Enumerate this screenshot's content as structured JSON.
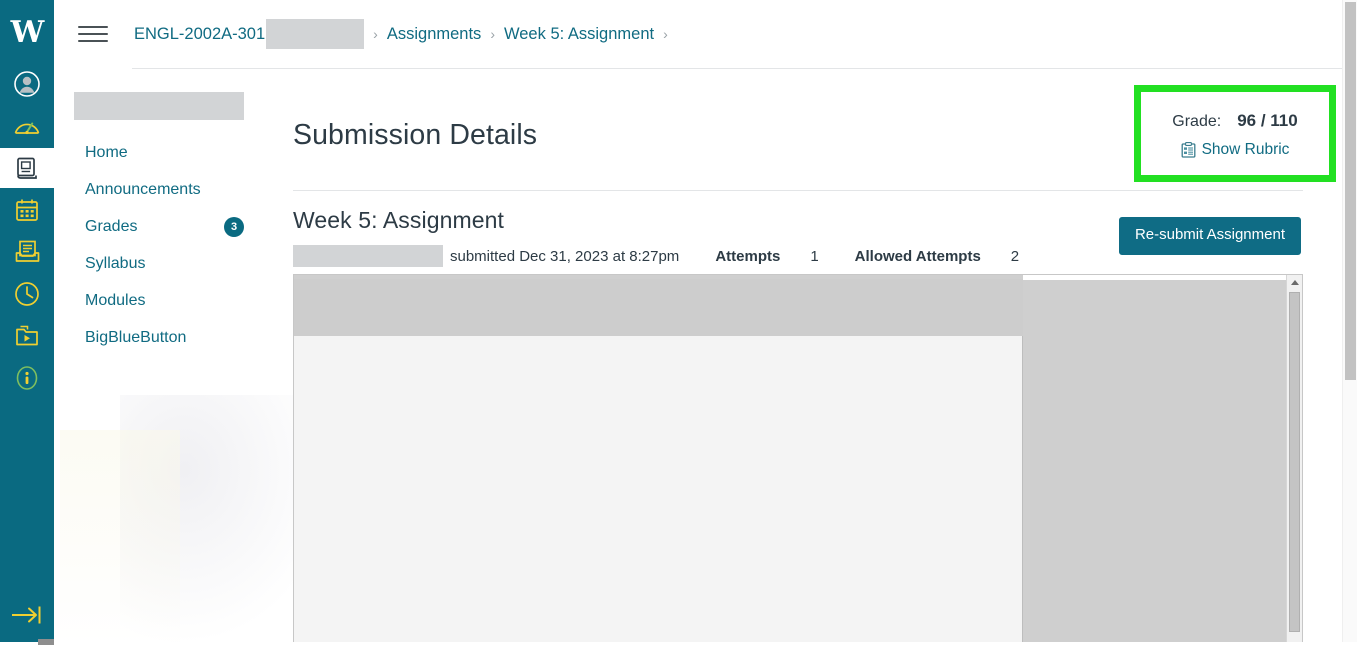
{
  "colors": {
    "brand_teal": "#0a6a81",
    "link_teal": "#106b82",
    "button_teal": "#0f6c85",
    "highlight_green": "#22e022",
    "text_dark": "#2d3b45",
    "nav_icon_gold": "#f0cf31",
    "redaction_grey": "#d2d4d6"
  },
  "global_nav": {
    "logo_text": "W",
    "logo_name": "wikipedia-w-logo",
    "items": [
      {
        "name": "account-icon",
        "label": "Account"
      },
      {
        "name": "dashboard-gauge-icon",
        "label": "Dashboard"
      },
      {
        "name": "courses-book-icon",
        "label": "Courses",
        "active": true
      },
      {
        "name": "calendar-icon",
        "label": "Calendar"
      },
      {
        "name": "inbox-icon",
        "label": "Inbox"
      },
      {
        "name": "history-clock-icon",
        "label": "History"
      },
      {
        "name": "studio-folder-play-icon",
        "label": "Studio"
      },
      {
        "name": "help-info-icon",
        "label": "Help"
      }
    ],
    "collapse": {
      "name": "expand-nav-arrow-icon",
      "label": "Expand navigation"
    }
  },
  "topbar": {
    "menu_icon": "hamburger-menu-icon",
    "breadcrumb": [
      {
        "label": "ENGL-2002A-301",
        "type": "link"
      },
      {
        "label": "",
        "type": "redacted"
      },
      {
        "label": "Assignments",
        "type": "link"
      },
      {
        "label": "Week 5: Assignment",
        "type": "link"
      }
    ],
    "separator": "›"
  },
  "course_nav": {
    "course_name_redacted": "",
    "items": [
      {
        "label": "Home",
        "badge": null
      },
      {
        "label": "Announcements",
        "badge": null
      },
      {
        "label": "Grades",
        "badge": "3"
      },
      {
        "label": "Syllabus",
        "badge": null
      },
      {
        "label": "Modules",
        "badge": null
      },
      {
        "label": "BigBlueButton",
        "badge": null
      }
    ]
  },
  "main": {
    "page_title": "Submission Details",
    "assignment_title": "Week 5: Assignment",
    "student_name_redacted": "",
    "submitted_text": "submitted Dec 31, 2023 at 8:27pm",
    "attempts_label": "Attempts",
    "attempts_value": "1",
    "allowed_attempts_label": "Allowed Attempts",
    "allowed_attempts_value": "2",
    "resubmit_button": "Re-submit Assignment"
  },
  "grade_box": {
    "label": "Grade:",
    "value": "96 / 110",
    "score": 96,
    "points_possible": 110,
    "rubric_link": "Show Rubric",
    "rubric_icon": "rubric-clipboard-icon",
    "highlighted": true
  },
  "preview": {
    "name": "submission-document-preview",
    "toolbar_redacted": "",
    "scroll_up_icon": "scroll-up-arrow-icon"
  }
}
